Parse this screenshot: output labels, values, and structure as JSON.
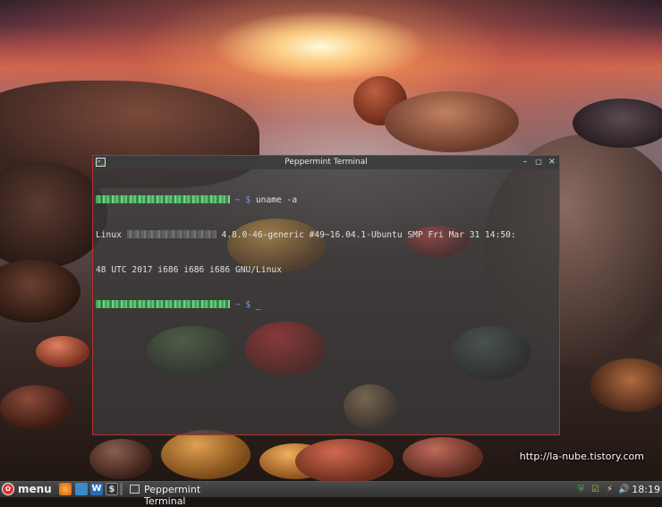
{
  "terminal": {
    "title": "Peppermint Terminal",
    "prompt_symbol": "~ $",
    "command": "uname -a",
    "output_kernel_prefix": "Linux",
    "output_line1_rest": "4.8.0-46-generic #49~16.04.1-Ubuntu SMP Fri Mar 31 14:50:",
    "output_line2": "48 UTC 2017 i686 i686 i686 GNU/Linux",
    "cursor": "_"
  },
  "watermark": "http://la-nube.tistory.com",
  "taskbar": {
    "menu_label": "menu",
    "task_label": "Peppermint Terminal",
    "launchers": [
      "firefox-icon",
      "file-manager-icon",
      "word-processor-icon",
      "terminal-icon"
    ],
    "clock": "18:19"
  },
  "colors": {
    "terminal_border": "#b33030",
    "prompt_user_green": "#3cc35c",
    "prompt_path_blue": "#7a9ad8",
    "menu_logo_red": "#d83030"
  }
}
